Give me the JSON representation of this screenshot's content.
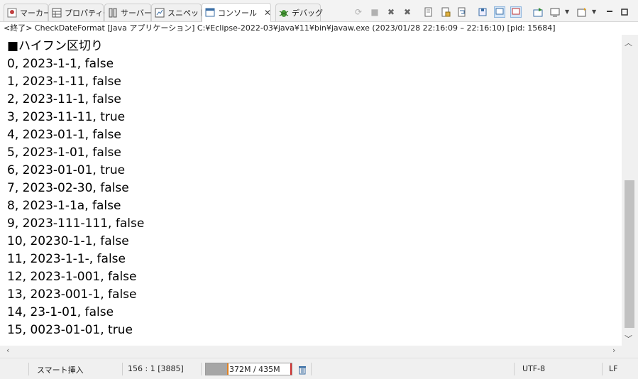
{
  "tabs": [
    {
      "label": "マーカー",
      "icon": "markers-icon"
    },
    {
      "label": "プロパティー",
      "icon": "properties-icon"
    },
    {
      "label": "サーバー",
      "icon": "servers-icon"
    },
    {
      "label": "スニペット",
      "icon": "snippets-icon"
    },
    {
      "label": "コンソール",
      "icon": "console-icon",
      "active": true
    },
    {
      "label": "デバッグ",
      "icon": "debug-icon"
    }
  ],
  "console": {
    "header": "<終了> CheckDateFormat [Java アプリケーション] C:¥Eclipse-2022-03¥java¥11¥bin¥javaw.exe  (2023/01/28 22:16:09 – 22:16:10) [pid: 15684]",
    "lines": [
      "■ハイフン区切り",
      "0, 2023-1-1, false",
      "1, 2023-1-11, false",
      "2, 2023-11-1, false",
      "3, 2023-11-11, true",
      "4, 2023-01-1, false",
      "5, 2023-1-01, false",
      "6, 2023-01-01, true",
      "7, 2023-02-30, false",
      "8, 2023-1-1a, false",
      "9, 2023-111-111, false",
      "10, 20230-1-1, false",
      "11, 2023-1-1-, false",
      "12, 2023-1-001, false",
      "13, 2023-001-1, false",
      "14, 23-1-01, false",
      "15, 0023-01-01, true"
    ]
  },
  "status": {
    "insert_mode": "スマート挿入",
    "position": "156 : 1 [3885]",
    "heap": "372M / 435M",
    "heap_used_fraction": 0.855,
    "encoding": "UTF-8",
    "line_delimiter": "LF"
  },
  "colors": {
    "tab_bar": "#f3f3f3",
    "heap_fill": "#a6a6a6",
    "scroll_thumb": "#c1c1c1"
  }
}
